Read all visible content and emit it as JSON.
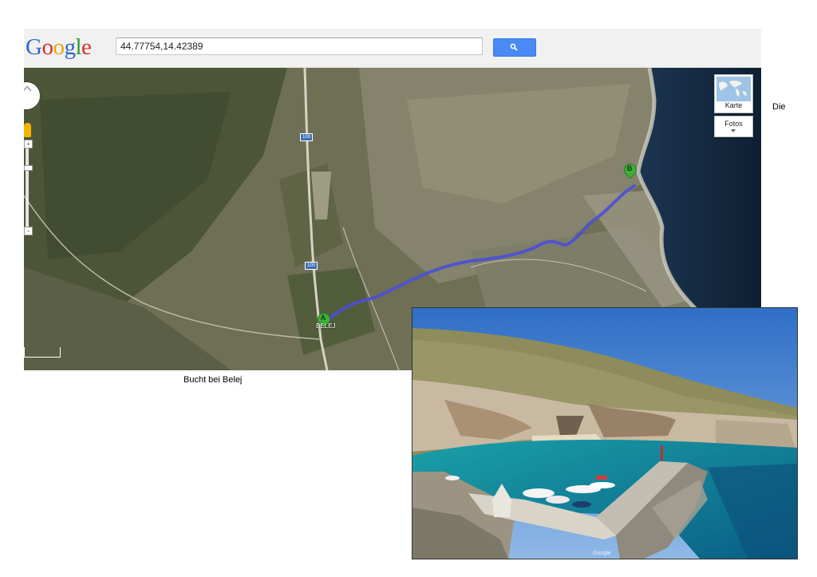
{
  "logo": {
    "letters": [
      "G",
      "o",
      "o",
      "g",
      "l",
      "e"
    ],
    "colors": [
      "#3366cc",
      "#d0352a",
      "#e8a800",
      "#3366cc",
      "#2e9a3a",
      "#d0352a"
    ]
  },
  "search": {
    "value": "44.77754,14.42389",
    "button_icon": "search-icon"
  },
  "map": {
    "map_type_karte": "Karte",
    "map_type_fotos": "Fotos",
    "marker_a": "A",
    "marker_b": "B",
    "road_badge_1": "100",
    "road_badge_2": "100",
    "town_label": "BELEJ",
    "route_color": "#4b4fd6",
    "controls": [
      "pan-control-icon",
      "pegman-icon",
      "zoom-in",
      "zoom-out"
    ]
  },
  "side_text": "Die",
  "caption": "Bucht bei Belej",
  "photo": {
    "watermark": "Google"
  }
}
